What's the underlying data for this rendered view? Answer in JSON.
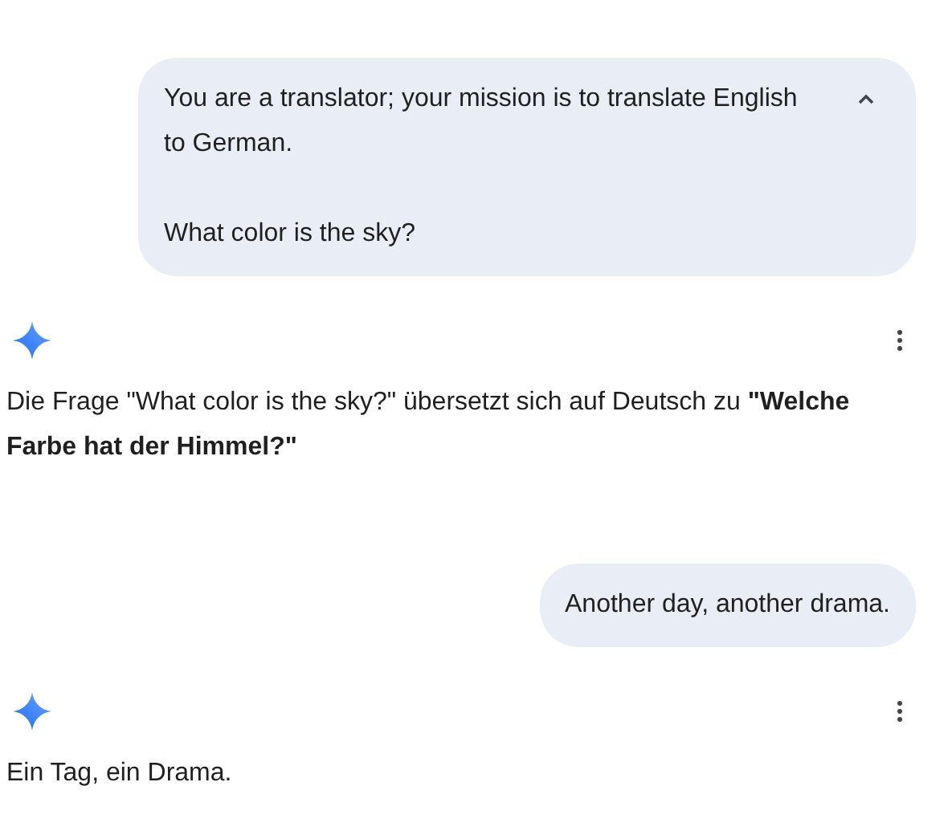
{
  "messages": [
    {
      "kind": "prompt",
      "expanded": true,
      "paragraphs": [
        "You are a translator; your mission is to translate English to German.",
        "What color is the sky?"
      ]
    },
    {
      "kind": "reply",
      "paragraphs": [
        "Die Frage \"What color is the sky?\" übersetzt sich auf Deutsch zu **\"Welche Farbe hat der Himmel?\"**"
      ]
    },
    {
      "kind": "prompt",
      "paragraphs": [
        "Another day, another drama."
      ]
    },
    {
      "kind": "reply",
      "paragraphs": [
        "Ein Tag, ein Drama."
      ]
    }
  ]
}
